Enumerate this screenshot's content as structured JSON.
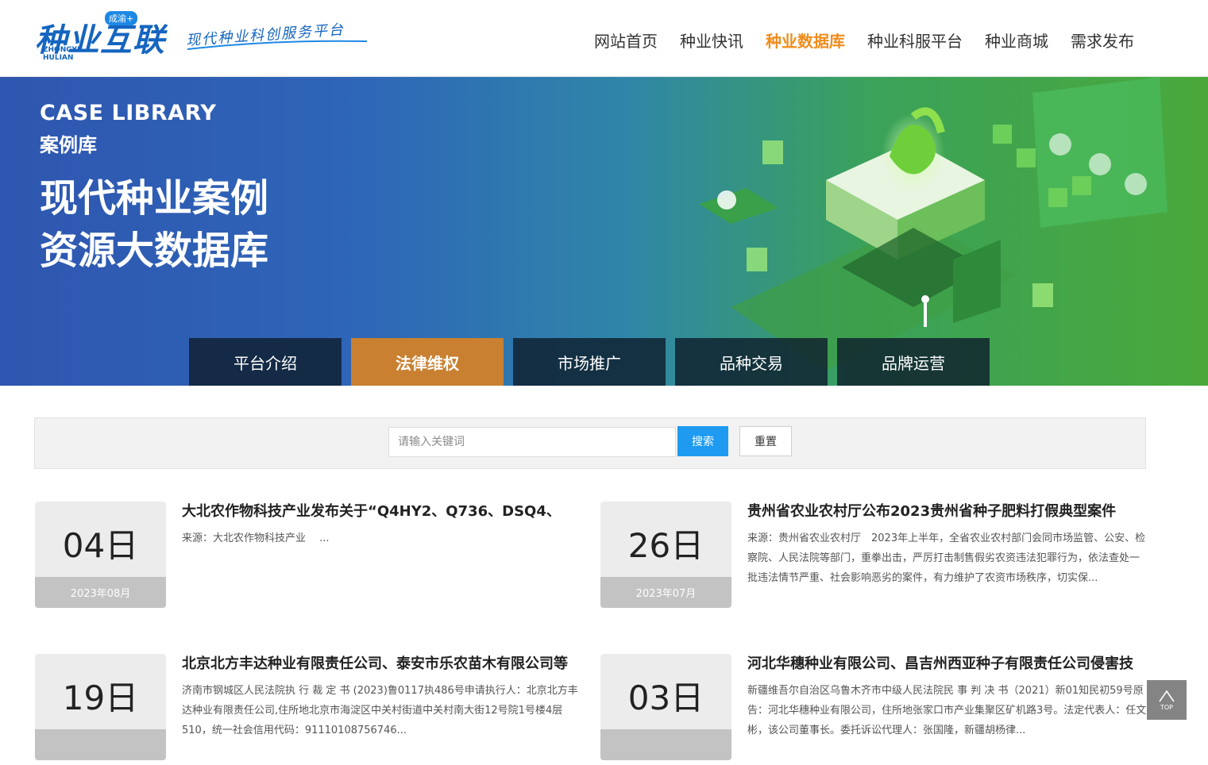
{
  "header": {
    "logo_text": "种业互联",
    "logo_badge": "成渝+",
    "logo_sub_line1": "ZHONGYE",
    "logo_sub_line2": "HULIAN",
    "slogan": "现代种业科创服务平台",
    "nav": [
      {
        "label": "网站首页",
        "active": false
      },
      {
        "label": "种业快讯",
        "active": false
      },
      {
        "label": "种业数据库",
        "active": true
      },
      {
        "label": "种业科服平台",
        "active": false
      },
      {
        "label": "种业商城",
        "active": false
      },
      {
        "label": "需求发布",
        "active": false
      }
    ]
  },
  "banner": {
    "title_en": "CASE LIBRARY",
    "title_cn": "案例库",
    "headline_line1": "现代种业案例",
    "headline_line2": "资源大数据库",
    "tabs": [
      {
        "label": "平台介绍",
        "active": false
      },
      {
        "label": "法律维权",
        "active": true
      },
      {
        "label": "市场推广",
        "active": false
      },
      {
        "label": "品种交易",
        "active": false
      },
      {
        "label": "品牌运营",
        "active": false
      }
    ]
  },
  "search": {
    "placeholder": "请输入关键词",
    "value": "",
    "search_label": "搜索",
    "reset_label": "重置"
  },
  "articles": [
    {
      "day": "04日",
      "year_month": "2023年08月",
      "title": "大北农作物科技产业发布关于“Q4HY2、Q736、DSQ4、",
      "desc": "来源：大北农作物科技产业　 ..."
    },
    {
      "day": "26日",
      "year_month": "2023年07月",
      "title": "贵州省农业农村厅公布2023贵州省种子肥料打假典型案件",
      "desc": "来源：贵州省农业农村厅　2023年上半年，全省农业农村部门会同市场监管、公安、检察院、人民法院等部门，重拳出击，严厉打击制售假劣农资违法犯罪行为，依法查处一批违法情节严重、社会影响恶劣的案件，有力维护了农资市场秩序，切实保..."
    },
    {
      "day": "19日",
      "year_month": "",
      "title": "北京北方丰达种业有限责任公司、泰安市乐农苗木有限公司等",
      "desc": "济南市钢城区人民法院执 行 裁 定 书 (2023)鲁0117执486号申请执行人：北京北方丰达种业有限责任公司,住所地北京市海淀区中关村街道中关村南大街12号院1号楼4层510，统一社会信用代码：91110108756746..."
    },
    {
      "day": "03日",
      "year_month": "",
      "title": "河北华穗种业有限公司、昌吉州西亚种子有限责任公司侵害技",
      "desc": "新疆维吾尔自治区乌鲁木齐市中级人民法院民 事 判 决 书（2021）新01知民初59号原告：河北华穗种业有限公司，住所地张家口市产业集聚区矿机路3号。法定代表人：任文彬，该公司董事长。委托诉讼代理人：张国隆，新疆胡杨律..."
    }
  ],
  "top_button": {
    "label": "TOP"
  }
}
